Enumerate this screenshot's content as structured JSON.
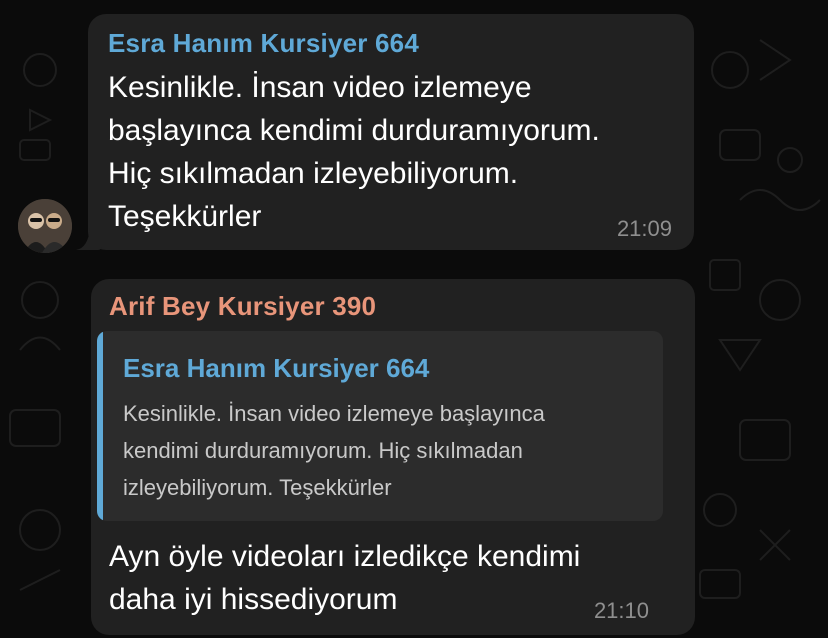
{
  "messages": [
    {
      "sender": "Esra Hanım Kursiyer 664",
      "lines": [
        "Kesinlikle. İnsan video izlemeye",
        "başlayınca kendimi durduramıyorum.",
        "Hiç sıkılmadan izleyebiliyorum.",
        "Teşekkürler"
      ],
      "time": "21:09",
      "sender_color": "#5fa9d7"
    },
    {
      "sender": "Arif Bey Kursiyer 390",
      "reply": {
        "sender": "Esra Hanım Kursiyer 664",
        "lines": [
          "Kesinlikle. İnsan video izlemeye başlayınca",
          "kendimi durduramıyorum. Hiç sıkılmadan",
          "izleyebiliyorum. Teşekkürler"
        ]
      },
      "lines": [
        "Ayn öyle videoları izledikçe kendimi",
        "daha iyi hissediyorum"
      ],
      "time": "21:10",
      "sender_color": "#e8957a"
    }
  ],
  "colors": {
    "background": "#0b0b0b",
    "bubble": "#212121",
    "reply_bar": "#5fa9d7"
  }
}
